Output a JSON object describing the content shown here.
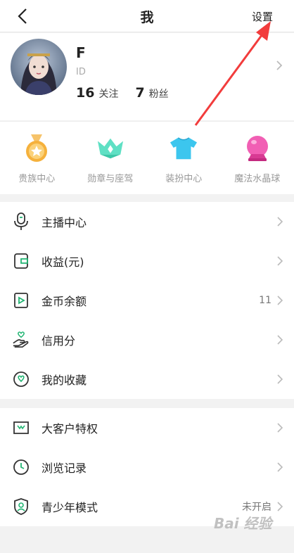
{
  "header": {
    "title": "我",
    "settings_label": "设置"
  },
  "profile": {
    "name": "F",
    "id_prefix": "ID",
    "following_count": "16",
    "following_label": "关注",
    "fans_count": "7",
    "fans_label": "粉丝"
  },
  "quick_actions": [
    {
      "label": "贵族中心",
      "icon": "medal-icon"
    },
    {
      "label": "勋章与座驾",
      "icon": "crown-icon"
    },
    {
      "label": "装扮中心",
      "icon": "tshirt-icon"
    },
    {
      "label": "魔法水晶球",
      "icon": "crystal-ball-icon"
    }
  ],
  "menu1": [
    {
      "label": "主播中心",
      "value": ""
    },
    {
      "label": "收益(元)",
      "value": ""
    },
    {
      "label": "金币余额",
      "value": "11"
    },
    {
      "label": "信用分",
      "value": ""
    },
    {
      "label": "我的收藏",
      "value": ""
    }
  ],
  "menu2": [
    {
      "label": "大客户特权",
      "value": ""
    },
    {
      "label": "浏览记录",
      "value": ""
    },
    {
      "label": "青少年模式",
      "value": "未开启"
    }
  ],
  "watermark": "Bai 经验",
  "colors": {
    "accent_green": "#22b573",
    "arrow_red": "#f23c3c"
  }
}
